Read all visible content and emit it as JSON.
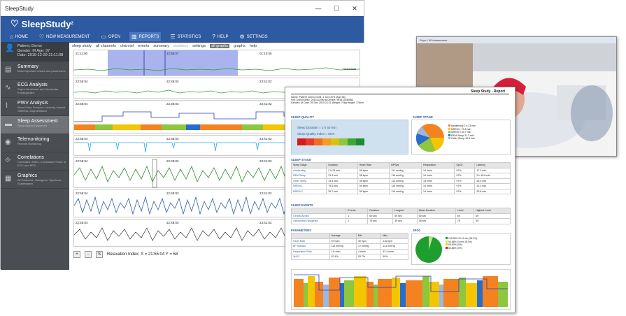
{
  "app": {
    "window_title": "SleepStudy",
    "brand": "SleepStudy",
    "brand_version": "2",
    "menu": [
      {
        "label": "HOME",
        "icon": "home-icon"
      },
      {
        "label": "NEW MEASUREMENT",
        "icon": "heart-icon"
      },
      {
        "label": "OPEN",
        "icon": "folder-icon"
      },
      {
        "label": "REPORTS",
        "icon": "chart-icon"
      },
      {
        "label": "STATISTICS",
        "icon": "list-icon"
      },
      {
        "label": "HELP",
        "icon": "help-icon"
      },
      {
        "label": "SETTINGS",
        "icon": "gears-icon"
      }
    ],
    "patient": {
      "name": "Patient, Demo",
      "gender_age": "Gender: M     Age: 37",
      "date": "Date:  2015-12-29 21:11:08"
    },
    "sidebar": [
      {
        "title": "Summary",
        "sub": "Most important results and parameters",
        "icon": "summary-icon"
      },
      {
        "title": "ECG Analysis",
        "sub": "Supra Ventricular and Ventricular Extrasystoles",
        "icon": "ecg-icon"
      },
      {
        "title": "PWV Analysis",
        "sub": "Blood Flow, Pressure, Velocity, Arterial Stiffness, Augmentation",
        "icon": "pwv-icon"
      },
      {
        "title": "Sleep Assessment",
        "sub": "Sleep Apnea Hypopnea",
        "icon": "bed-icon"
      },
      {
        "title": "Telemonitoring",
        "sub": "Remote Monitoring",
        "icon": "eye-icon"
      },
      {
        "title": "Correlations",
        "sub": "Correlation Index, Correlation Power of ECG and PPG",
        "icon": "correlation-icon"
      },
      {
        "title": "Graphics",
        "sub": "All Channels, Histogram, Spectrum, Scattergram",
        "icon": "graphics-icon"
      }
    ],
    "tabs": [
      "sleep study",
      "all channels",
      "channel",
      "events",
      "summary",
      "statistics",
      "settings",
      "all graphs",
      "graphs",
      "help"
    ],
    "plots": [
      {
        "t1": "21:11:00",
        "t2": "22:55:07",
        "t3": "01:10:55",
        "label": "Heart Rate"
      },
      {
        "t1": "22:55:04",
        "t2": "22:48:03",
        "t3": "23:41:02"
      },
      {
        "t1": "22:55:04",
        "t2": "22:48:03",
        "t3": "23:41:02"
      },
      {
        "t1": "22:55:04",
        "t2": "22:48:03",
        "t3": "23:41:02"
      },
      {
        "t1": "22:55:04",
        "t2": "22:48:03",
        "t3": "23:41:02"
      },
      {
        "t1": "22:55:04",
        "t2": "22:48:03",
        "t3": "23:41:02"
      },
      {
        "t1": "22:55:04",
        "t2": "22:48:03",
        "t3": "23:41:02"
      }
    ],
    "bottom": {
      "plus": "+",
      "minus": "-",
      "s": "S",
      "relax": "Relaxation Index:   X = 21:55:04   Y = 58"
    }
  },
  "report": {
    "title": "Sleep Study - Report",
    "patient_line": "Name: Patient, Demo     DOB: 1 Jun 1978 (Age 38)",
    "file_line": "File: DemoSleep_20151229a.rsl     Device: 991872040663",
    "gender_line": "Gender: M     Date: 29 Dec 2015 21:11     Weight: 70kg     Height: 178cm",
    "sleep_quality": {
      "heading": "SLEEP QUALITY",
      "duration": "Sleep Duration = 2 h 50 min",
      "index": "Sleep Quality Index = 69.0"
    },
    "sleep_stage_heading": "SLEEP STAGE",
    "pie_legend": [
      "Awakening 2 h 23 min",
      "NREM 1 79.5 min",
      "NREM 3 39.7 min",
      "REM Sleep 31.3 min",
      "Other Sleep 19.5 min"
    ],
    "stage_table": {
      "heading": "SLEEP STAGE",
      "headers": [
        "Sleep Stage",
        "Duration",
        "Heart Rate",
        "BPSys",
        "Respiration",
        "SpO2",
        "Latency"
      ],
      "rows": [
        [
          "Awakening",
          "2 h 23 min",
          "58 bpm",
          "111 mmHg",
          "14 r/min",
          "97%",
          "17.3 min"
        ],
        [
          "REM Sleep",
          "31.3 min",
          "58 bpm",
          "115 mmHg",
          "14 r/min",
          "97%",
          "2 h 18.8 min"
        ],
        [
          "Other Sleep",
          "19.5 min",
          "56 bpm",
          "113 mmHg",
          "14 r/min",
          "97%",
          "26.3 min"
        ],
        [
          "NREM 1",
          "79.5 min",
          "55 bpm",
          "115 mmHg",
          "14 r/min",
          "97%",
          "31.3 min"
        ],
        [
          "NREM 3",
          "39.7 min",
          "55 bpm",
          "115 mmHg",
          "14 r/min",
          "97%",
          "33.8 min"
        ]
      ]
    },
    "events_table": {
      "heading": "SLEEP EVENTS",
      "headers": [
        "",
        "Events",
        "Duration",
        "Longest",
        "Mean Duration",
        "Level",
        "Highest Level"
      ],
      "rows": [
        [
          "Central Apnea",
          "1",
          "69 sec",
          "69 sec",
          "69 sec",
          "69",
          "69"
        ],
        [
          "Obstructive Hypopnea",
          "2",
          "76 sec",
          "39 sec",
          "38 sec",
          "76",
          "39"
        ]
      ]
    },
    "params_table": {
      "heading": "PARAMETERS",
      "headers": [
        "",
        "Average",
        "Min",
        "Max"
      ],
      "rows": [
        [
          "Heart Rate",
          "57 bpm",
          "40 bpm",
          "210 bpm"
        ],
        [
          "BP Systolic",
          "113 mmHg",
          "72 mmHg",
          "141 mmHg"
        ],
        [
          "Respiration Rate",
          "14 r/min",
          "4 r/min",
          "33.4 r/min"
        ],
        [
          "SpO2",
          "97.4%",
          "93.7%",
          "99%"
        ]
      ]
    },
    "spo2_heading": "SPO2",
    "spo2_legend": [
      "100-96%  5 h 3 min (94.2%)",
      "96-86%   15 min (5.3%)",
      "86-80%   (0%)",
      "80-86%   (0%)"
    ],
    "colors": {
      "awakening": "#f58220",
      "nrem1": "#f2c600",
      "nrem3": "#8dc63f",
      "rem": "#2a6cc9",
      "other": "#9bb8e0",
      "brand": "#2d5aa0"
    }
  },
  "photo_title": "Ruyn.I IIII ulaamrmwa.."
}
